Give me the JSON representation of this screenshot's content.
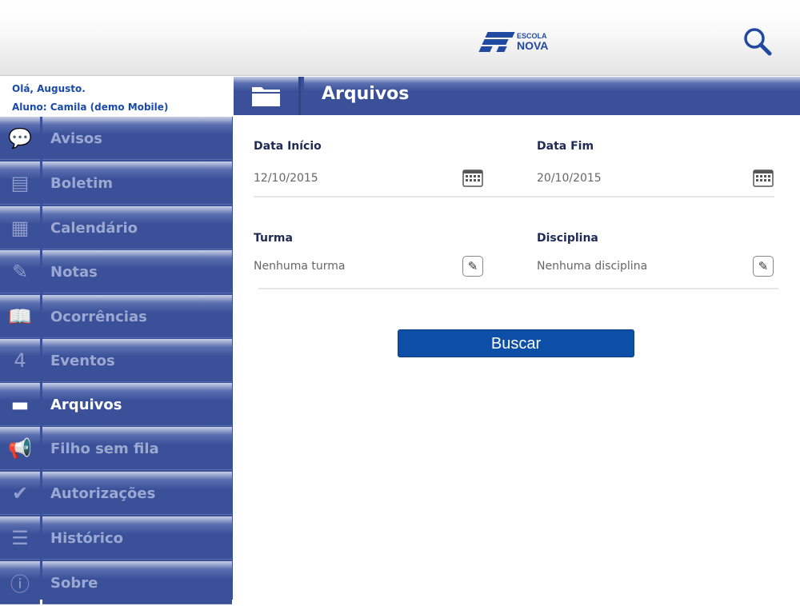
{
  "logo": {
    "line1": "ESCOLA",
    "line2": "NOVA"
  },
  "greeting": {
    "hello": "Olá, Augusto.",
    "student": "Aluno: Camila (demo Mobile)"
  },
  "sidebar": {
    "items": [
      {
        "label": "Avisos",
        "icon": "chat-icon"
      },
      {
        "label": "Boletim",
        "icon": "document-icon"
      },
      {
        "label": "Calendário",
        "icon": "calendar-icon"
      },
      {
        "label": "Notas",
        "icon": "note-edit-icon"
      },
      {
        "label": "Ocorrências",
        "icon": "book-icon"
      },
      {
        "label": "Eventos",
        "icon": "event-calendar-icon"
      },
      {
        "label": "Arquivos",
        "icon": "folder-icon",
        "active": true
      },
      {
        "label": "Filho sem fila",
        "icon": "megaphone-icon"
      },
      {
        "label": "Autorizações",
        "icon": "checkmark-icon"
      },
      {
        "label": "Histórico",
        "icon": "list-document-icon"
      },
      {
        "label": "Sobre",
        "icon": "info-icon"
      }
    ]
  },
  "header": {
    "title": "Arquivos"
  },
  "form": {
    "start_label": "Data Início",
    "start_value": "12/10/2015",
    "end_label": "Data Fim",
    "end_value": "20/10/2015",
    "class_label": "Turma",
    "class_value": "Nenhuma turma",
    "subject_label": "Disciplina",
    "subject_value": "Nenhuma disciplina",
    "search_button": "Buscar"
  },
  "event_day": "4"
}
